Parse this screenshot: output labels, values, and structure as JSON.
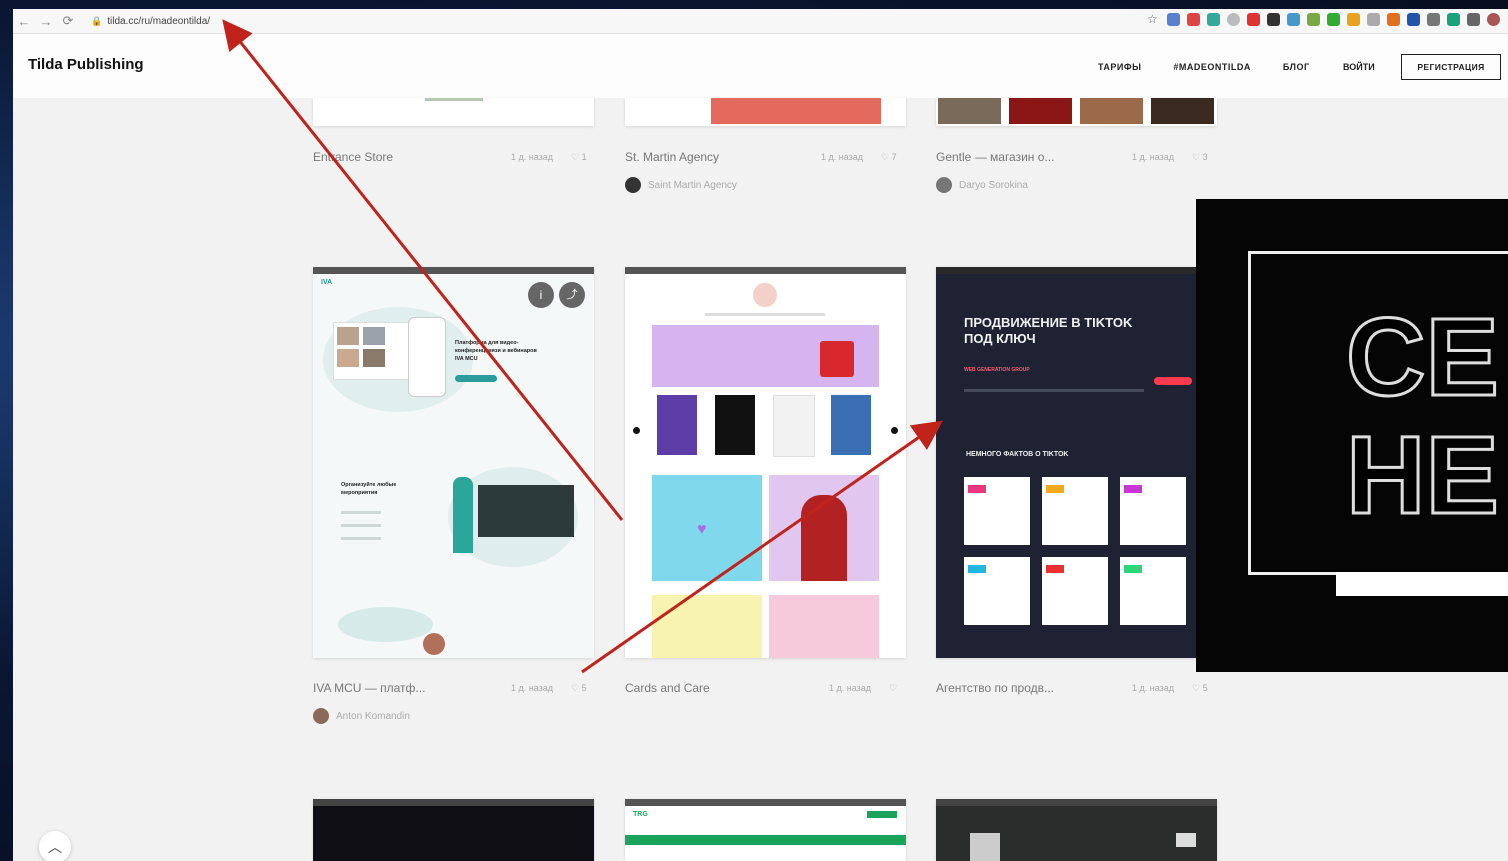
{
  "browser": {
    "url": "tilda.cc/ru/madeontilda/"
  },
  "header": {
    "logo": "Tilda Publishing",
    "nav": [
      "ТАРИФЫ",
      "#MADEONTILDA",
      "БЛОГ"
    ],
    "login": "ВОЙТИ",
    "register": "РЕГИСТРАЦИЯ"
  },
  "row1": [
    {
      "title": "Entrance Store",
      "time": "1 д. назад",
      "likes": "♡ 1",
      "author": ""
    },
    {
      "title": "St. Martin Agency",
      "time": "1 д. назад",
      "likes": "♡ 7",
      "author": "Saint Martin Agency"
    },
    {
      "title": "Gentle — магазин о...",
      "time": "1 д. назад",
      "likes": "♡ 3",
      "author": "Daryo Sorokina"
    }
  ],
  "row2": [
    {
      "title": "IVA MCU — платф...",
      "time": "1 д. назад",
      "likes": "♡ 5",
      "author": "Anton Komandin"
    },
    {
      "title": "Cards and Care",
      "time": "1 д. назад",
      "likes": "♡",
      "author": ""
    },
    {
      "title": "Агентство по продв...",
      "time": "1 д. назад",
      "likes": "♡ 5",
      "author": ""
    }
  ],
  "cards": {
    "iva": {
      "heading": "Платформа для видео-конференцсвязи и вебинаров IVA MCU",
      "section": "Организуйте любые мероприятия"
    },
    "tiktok": {
      "heading": "ПРОДВИЖЕНИЕ В TIKTOK ПОД КЛЮЧ",
      "sub": "НЕМНОГО ФАКТОВ О TIKTOK",
      "company": "WEB GENERATION GROUP"
    }
  },
  "overlay": {
    "text": "СЕ НЕ"
  },
  "colors": {
    "accent_arrow": "#c0231b",
    "page_bg": "#f2f2f2",
    "tiktok_bg": "#1e2233"
  }
}
